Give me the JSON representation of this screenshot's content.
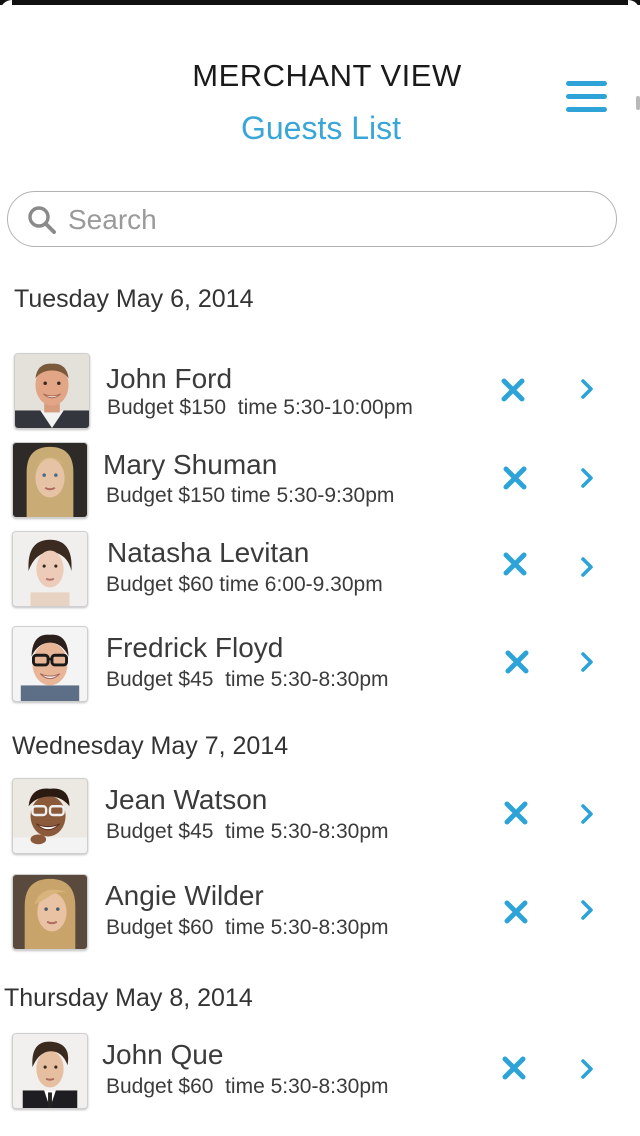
{
  "header": {
    "title": "MERCHANT VIEW",
    "subtitle": "Guests List"
  },
  "search": {
    "placeholder": "Search",
    "value": ""
  },
  "icons": {
    "menu": "hamburger-menu-icon",
    "search": "magnifier-icon",
    "remove": "x-icon",
    "open": "chevron-right-icon"
  },
  "colors": {
    "accent": "#2ea3d8",
    "text": "#3b3b3b"
  },
  "days": [
    {
      "label": "Tuesday May 6, 2014",
      "guests": [
        {
          "name": "John Ford",
          "detail": "Budget $150  time 5:30-10:00pm"
        },
        {
          "name": "Mary Shuman",
          "detail": "Budget $150 time 5:30-9:30pm"
        },
        {
          "name": "Natasha Levitan",
          "detail": "Budget $60 time 6:00-9.30pm"
        },
        {
          "name": "Fredrick Floyd",
          "detail": "Budget $45  time 5:30-8:30pm"
        }
      ]
    },
    {
      "label": "Wednesday May 7, 2014",
      "guests": [
        {
          "name": "Jean Watson",
          "detail": "Budget $45  time 5:30-8:30pm"
        },
        {
          "name": "Angie Wilder",
          "detail": "Budget $60  time 5:30-8:30pm"
        }
      ]
    },
    {
      "label": "Thursday May 8, 2014",
      "guests": [
        {
          "name": "John Que",
          "detail": "Budget $60  time 5:30-8:30pm"
        }
      ]
    }
  ]
}
